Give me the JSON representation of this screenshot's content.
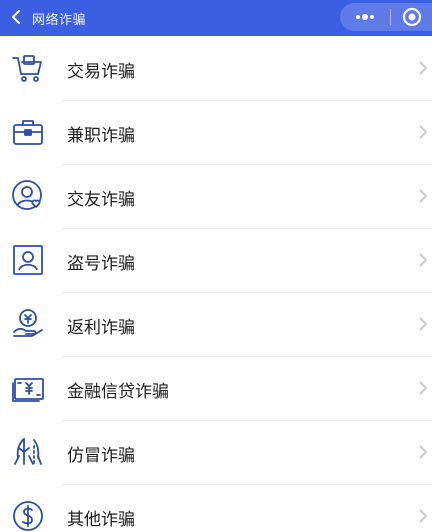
{
  "header": {
    "title": "网络诈骗",
    "back_icon": "chevron-left-icon",
    "more_icon": "more-dots-icon",
    "close_icon": "target-close-icon",
    "bg_color": "#3b5fe2"
  },
  "accent_color": "#2b4ea8",
  "items": [
    {
      "label": "交易诈骗",
      "icon": "shopping-cart-icon"
    },
    {
      "label": "兼职诈骗",
      "icon": "briefcase-icon"
    },
    {
      "label": "交友诈骗",
      "icon": "user-heart-icon"
    },
    {
      "label": "盗号诈骗",
      "icon": "account-card-icon"
    },
    {
      "label": "返利诈骗",
      "icon": "coin-hand-icon"
    },
    {
      "label": "金融信贷诈骗",
      "icon": "money-bill-icon"
    },
    {
      "label": "仿冒诈骗",
      "icon": "impersonation-icon"
    },
    {
      "label": "其他诈骗",
      "icon": "dollar-circle-icon"
    }
  ]
}
